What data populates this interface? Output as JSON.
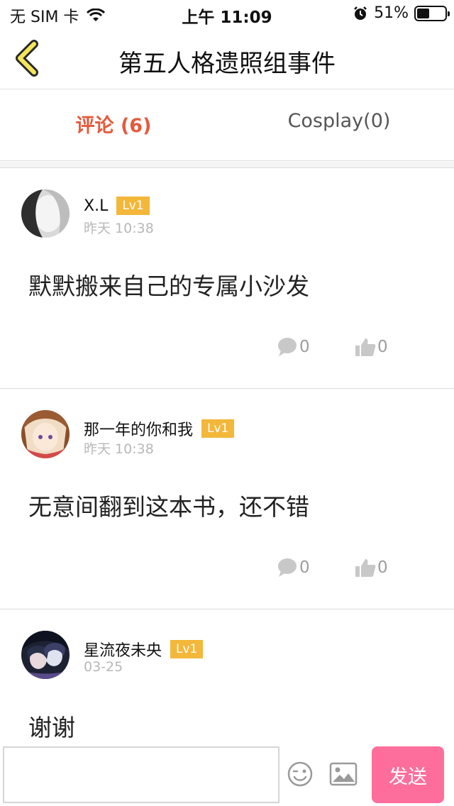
{
  "status_bar": {
    "carrier": "无 SIM 卡",
    "time": "上午 11:09",
    "battery": "51%",
    "battery_level": 0.51
  },
  "nav": {
    "title": "第五人格遗照组事件"
  },
  "tabs": [
    {
      "label": "评论 (6)"
    },
    {
      "label": "Cosplay(0)"
    }
  ],
  "comments": [
    {
      "name": "X.L",
      "level": "Lv1",
      "date": "昨天 10:38",
      "text": "默默搬来自己的专属小沙发",
      "replies": "0",
      "likes": "0"
    },
    {
      "name": "那一年的你和我",
      "level": "Lv1",
      "date": "昨天 10:38",
      "text": "无意间翻到这本书，还不错",
      "replies": "0",
      "likes": "0"
    },
    {
      "name": "星流夜未央",
      "level": "Lv1",
      "date": "03-25",
      "text": "谢谢"
    }
  ],
  "input_bar": {
    "placeholder": "",
    "send_label": "发送"
  },
  "colors": {
    "accent": "#e45a3c",
    "level_badge": "#f3b73a",
    "send_button": "#fd6e9c",
    "back_arrow": "#f5e65a"
  }
}
